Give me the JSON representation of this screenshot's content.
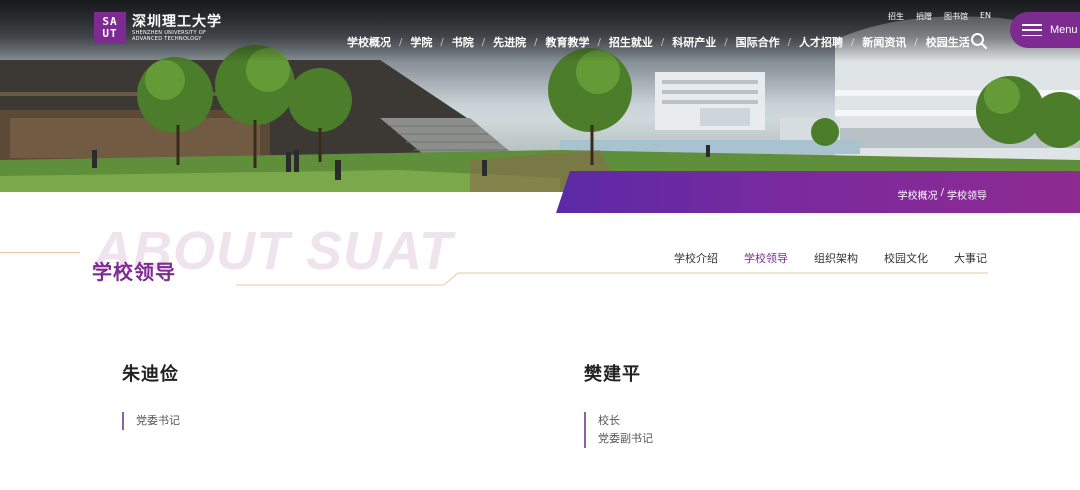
{
  "header": {
    "logo": {
      "mark_top": "SA",
      "mark_bottom": "UT",
      "name_cn": "深圳理工大学",
      "name_en_line1": "SHENZHEN UNIVERSITY OF",
      "name_en_line2": "ADVANCED TECHNOLOGY"
    },
    "utility_links": [
      "招生",
      "捐赠",
      "图书馆",
      "EN"
    ],
    "nav": [
      "学校概况",
      "学院",
      "书院",
      "先进院",
      "教育教学",
      "招生就业",
      "科研产业",
      "国际合作",
      "人才招聘",
      "新闻资讯",
      "校园生活"
    ],
    "menu_label": "Menu"
  },
  "breadcrumb": {
    "parent": "学校概况",
    "separator": "/",
    "current": "学校领导"
  },
  "section": {
    "watermark": "ABOUT SUAT",
    "title": "学校领导",
    "tabs": [
      {
        "label": "学校介绍",
        "active": false
      },
      {
        "label": "学校领导",
        "active": true
      },
      {
        "label": "组织架构",
        "active": false
      },
      {
        "label": "校园文化",
        "active": false
      },
      {
        "label": "大事记",
        "active": false
      }
    ]
  },
  "leaders": [
    {
      "name": "朱迪俭",
      "roles": [
        "党委书记"
      ]
    },
    {
      "name": "樊建平",
      "roles": [
        "校长",
        "党委副书记"
      ]
    }
  ],
  "colors": {
    "brand_purple": "#7d2a91",
    "band_start": "#5b2aa6",
    "watermark": "#efe4ee",
    "accent_line": "#e6c9a0"
  },
  "icons": [
    "search-icon",
    "menu-icon",
    "logo-icon"
  ]
}
